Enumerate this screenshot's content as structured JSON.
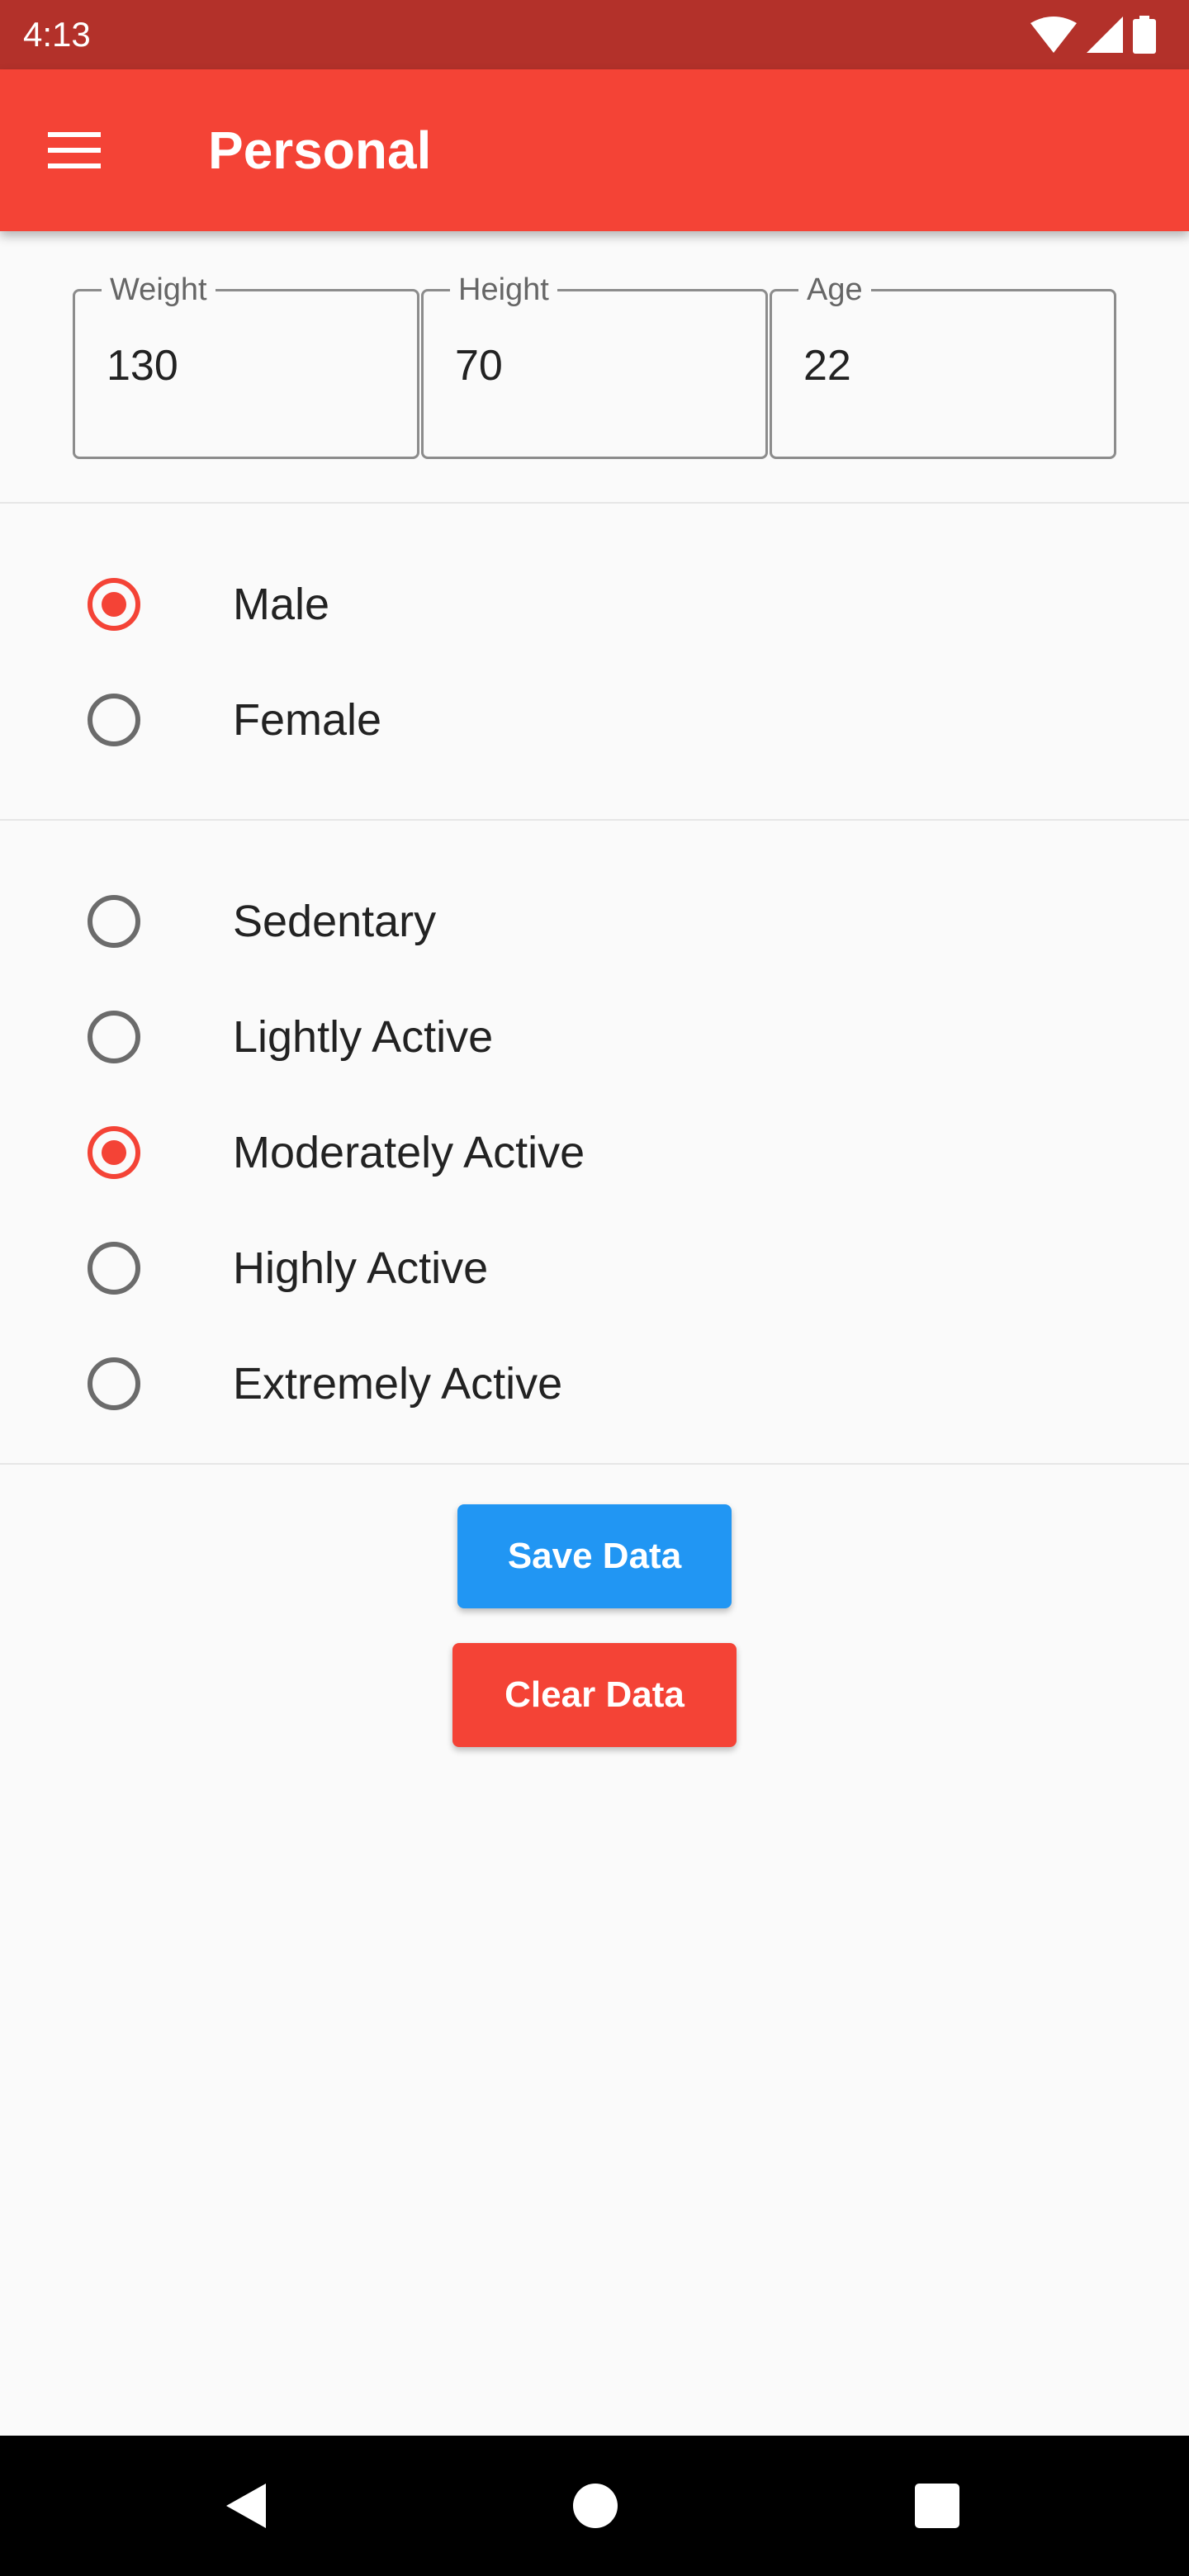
{
  "status_bar": {
    "time": "4:13",
    "icons": [
      "wifi-icon",
      "signal-icon",
      "battery-icon"
    ]
  },
  "app_bar": {
    "title": "Personal",
    "menu_icon": "menu-icon",
    "color": "#f44336"
  },
  "fields": [
    {
      "label": "Weight",
      "value": "130"
    },
    {
      "label": "Height",
      "value": "70"
    },
    {
      "label": "Age",
      "value": "22"
    }
  ],
  "gender": {
    "options": [
      "Male",
      "Female"
    ],
    "selected": "Male"
  },
  "activity": {
    "options": [
      "Sedentary",
      "Lightly Active",
      "Moderately Active",
      "Highly Active",
      "Extremely Active"
    ],
    "selected": "Moderately Active"
  },
  "buttons": {
    "save_label": "Save Data",
    "save_color": "#2196f3",
    "clear_label": "Clear Data",
    "clear_color": "#f44336"
  },
  "nav_bar": {
    "icons": [
      "back-icon",
      "home-icon",
      "recents-icon"
    ]
  }
}
